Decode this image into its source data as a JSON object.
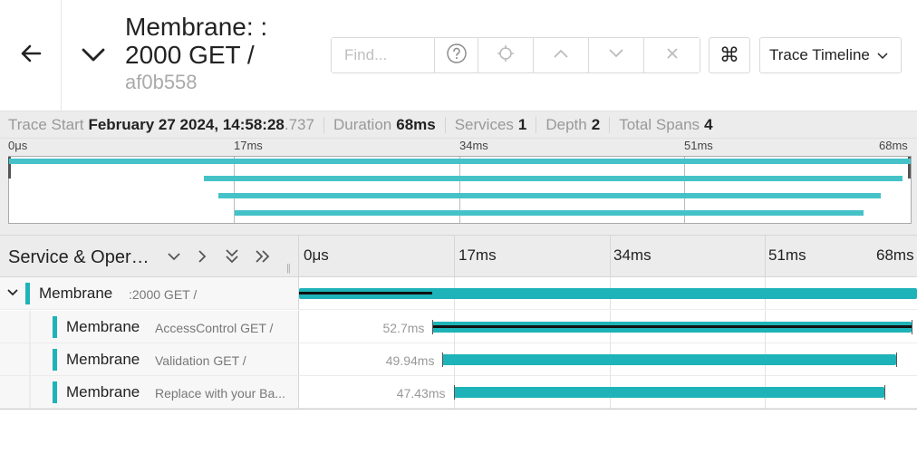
{
  "header": {
    "title": "Membrane: : 2000 GET /",
    "trace_id": "af0b558",
    "search_placeholder": "Find...",
    "view_select_label": "Trace Timeline",
    "cmd_label": "⌘"
  },
  "summary": {
    "trace_start_label": "Trace Start",
    "trace_start_value": "February 27 2024, 14:58:28",
    "trace_start_ms": ".737",
    "duration_label": "Duration",
    "duration_value": "68ms",
    "services_label": "Services",
    "services_value": "1",
    "depth_label": "Depth",
    "depth_value": "2",
    "total_spans_label": "Total Spans",
    "total_spans_value": "4"
  },
  "minimap": {
    "ticks": [
      "0μs",
      "17ms",
      "34ms",
      "51ms",
      "68ms"
    ]
  },
  "timeline": {
    "column_title": "Service & Operation",
    "ticks": [
      "0μs",
      "17ms",
      "34ms",
      "51ms",
      "68ms"
    ]
  },
  "spans": [
    {
      "service": "Membrane",
      "operation": ":2000 GET /",
      "duration": "",
      "start_ms": 0,
      "duration_ms": 68,
      "depth": 0
    },
    {
      "service": "Membrane",
      "operation": "AccessControl GET /",
      "duration": "52.7ms",
      "start_ms": 14.7,
      "duration_ms": 52.7,
      "depth": 1
    },
    {
      "service": "Membrane",
      "operation": "Validation GET /",
      "duration": "49.94ms",
      "start_ms": 15.8,
      "duration_ms": 49.94,
      "depth": 1
    },
    {
      "service": "Membrane",
      "operation": "Replace with your Ba...",
      "duration": "47.43ms",
      "start_ms": 17.0,
      "duration_ms": 47.43,
      "depth": 1
    }
  ],
  "colors": {
    "span": "#1eb3b8",
    "minimap_span": "#45c2c8"
  }
}
